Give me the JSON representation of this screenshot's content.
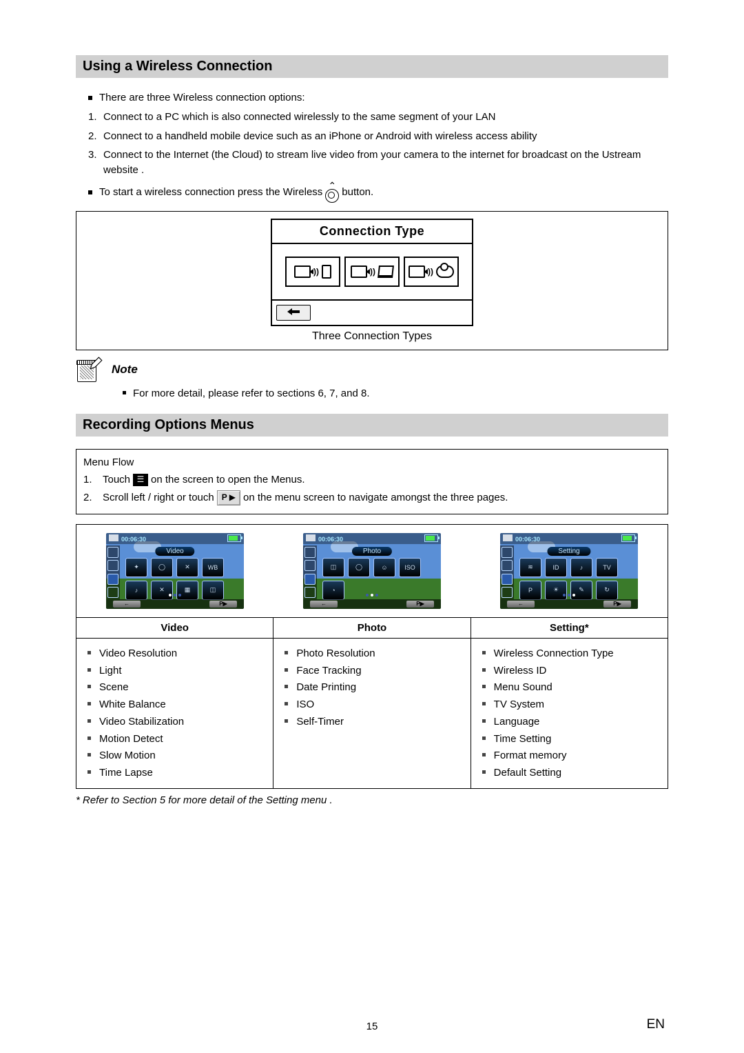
{
  "section1": {
    "title": "Using a Wireless Connection",
    "intro": "There are three Wireless connection options:",
    "items": [
      "Connect to a PC which is also connected wirelessly to the same segment of your LAN",
      "Connect to a handheld mobile device such as an iPhone or Android with wireless access ability",
      "Connect to the Internet (the Cloud) to stream live video from your camera to the internet for broadcast on the Ustream website ."
    ],
    "start_prefix": "To start a wireless connection press the Wireless",
    "start_suffix": "button.",
    "panel_title": "Connection Type",
    "caption": "Three Connection Types",
    "note_label": "Note",
    "note_text": "For more detail, please refer to sections 6, 7, and 8."
  },
  "section2": {
    "title": "Recording Options Menus",
    "menuflow_label": "Menu Flow",
    "step1_a": "Touch",
    "step1_b": "on the screen to open the Menus.",
    "step2_a": "Scroll left / right or touch",
    "step2_b": "on the menu screen to navigate amongst the three pages.",
    "nav_label": "P",
    "screens": [
      {
        "tab": "Video",
        "time": "00:06:30",
        "icons": [
          "✦",
          "◯",
          "✕",
          "WB",
          "♪",
          "✕",
          "▦",
          "◫"
        ]
      },
      {
        "tab": "Photo",
        "time": "00:06:30",
        "icons": [
          "◫",
          "◯",
          "☺",
          "ISO",
          "◔"
        ]
      },
      {
        "tab": "Setting",
        "time": "00:06:30",
        "icons": [
          "≋",
          "ID",
          "♪",
          "TV",
          "P",
          "☀",
          "✎",
          "↻"
        ]
      }
    ],
    "columns": [
      {
        "head": "Video",
        "items": [
          "Video Resolution",
          "Light",
          "Scene",
          "White Balance",
          "Video Stabilization",
          "Motion Detect",
          "Slow Motion",
          "Time Lapse"
        ]
      },
      {
        "head": "Photo",
        "items": [
          "Photo Resolution",
          "Face Tracking",
          "Date Printing",
          "ISO",
          "Self-Timer"
        ]
      },
      {
        "head": "Setting*",
        "items": [
          "Wireless Connection Type",
          "Wireless ID",
          "Menu Sound",
          "TV System",
          "Language",
          "Time Setting",
          "Format memory",
          "Default Setting"
        ]
      }
    ],
    "footnote": "* Refer to Section 5 for more detail of the Setting menu ."
  },
  "page_num": "15",
  "lang": "EN"
}
